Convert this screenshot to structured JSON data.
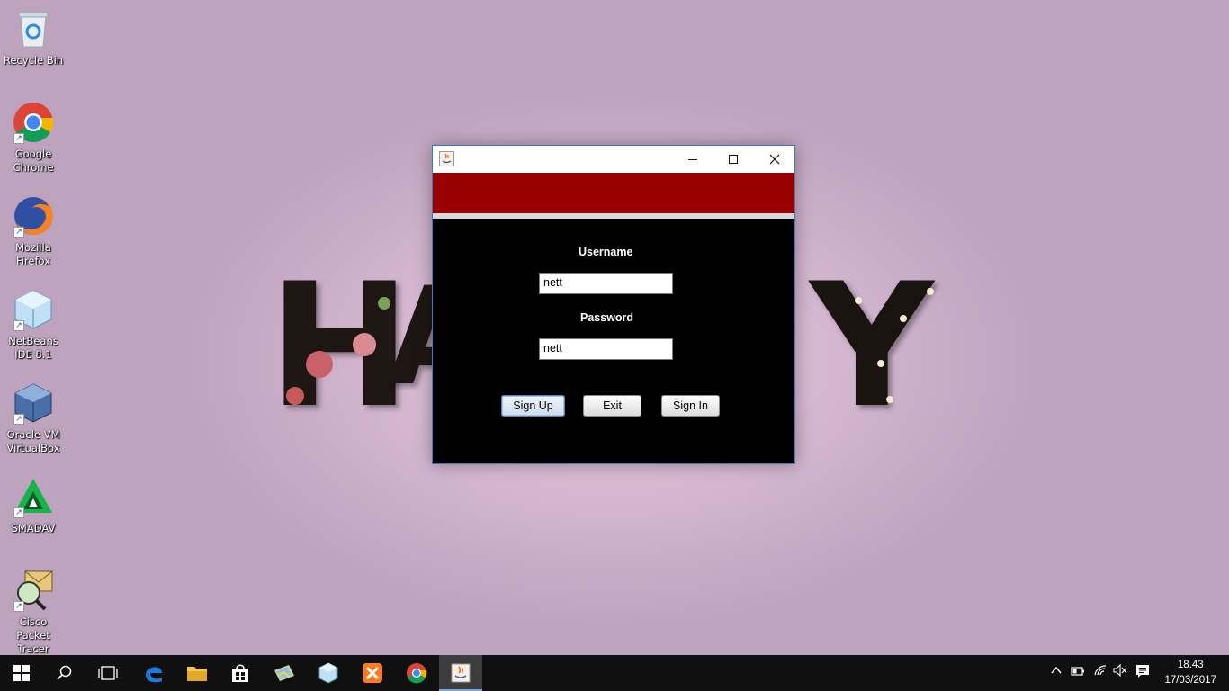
{
  "desktop": {
    "icons": [
      {
        "label": "Recycle Bin",
        "icon": "recycle-bin-icon"
      },
      {
        "label": "Google Chrome",
        "icon": "chrome-icon"
      },
      {
        "label": "Mozilla Firefox",
        "icon": "firefox-icon"
      },
      {
        "label": "NetBeans IDE 8.1",
        "icon": "netbeans-icon"
      },
      {
        "label": "Oracle VM VirtualBox",
        "icon": "virtualbox-icon"
      },
      {
        "label": "SMADAV",
        "icon": "smadav-icon"
      },
      {
        "label": "Cisco Packet Tracer",
        "icon": "packet-tracer-icon"
      }
    ],
    "wallpaper_text": {
      "left": "H",
      "left2": "A",
      "right": "Y"
    }
  },
  "window": {
    "title": "",
    "icon": "java-icon",
    "colors": {
      "band": "#990000",
      "content": "#000000"
    },
    "form": {
      "username_label": "Username",
      "username_value": "nett",
      "password_label": "Password",
      "password_value": "nett",
      "signup_label": "Sign Up",
      "exit_label": "Exit",
      "signin_label": "Sign In"
    }
  },
  "taskbar": {
    "items": [
      "start-icon",
      "search-icon",
      "task-view-icon",
      "edge-icon",
      "file-explorer-icon",
      "store-icon",
      "photos-icon",
      "netbeans-icon",
      "xampp-icon",
      "chrome-icon",
      "java-icon"
    ],
    "clock": {
      "time": "18.43",
      "date": "17/03/2017"
    }
  }
}
